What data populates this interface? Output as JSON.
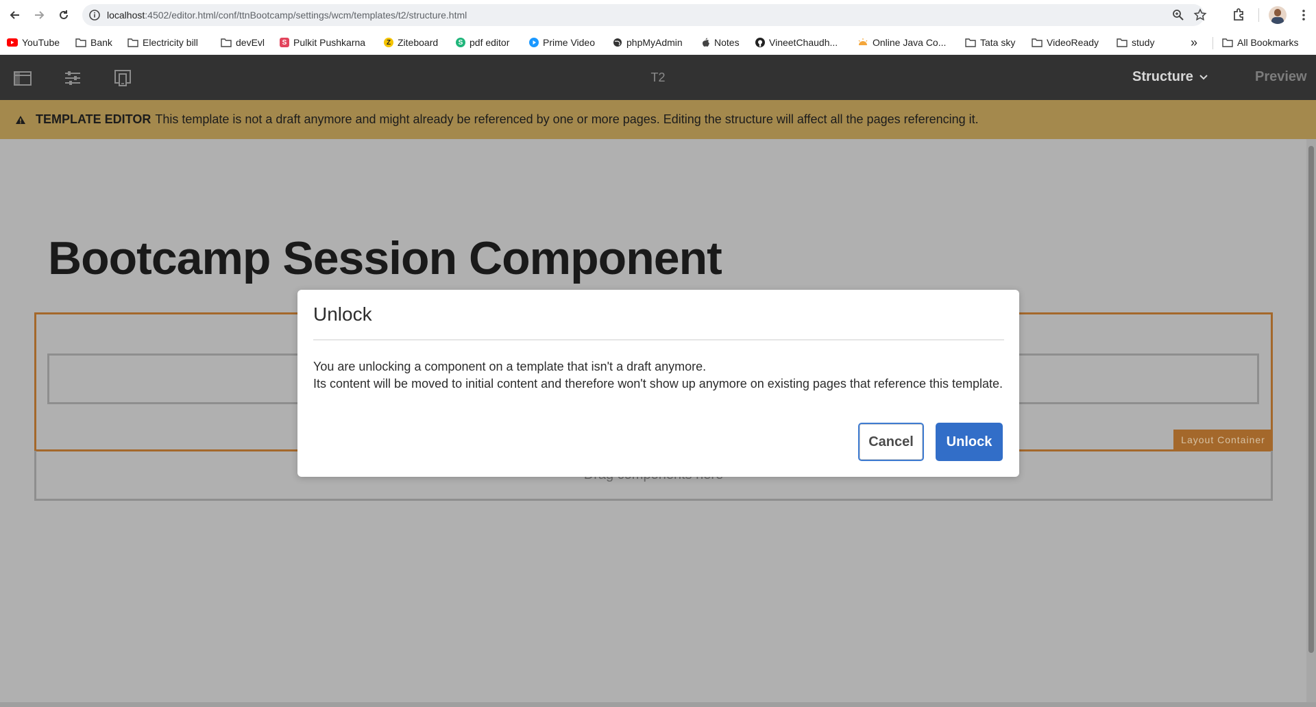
{
  "browser": {
    "url_host": "localhost",
    "url_rest": ":4502/editor.html/conf/ttnBootcamp/settings/wcm/templates/t2/structure.html",
    "bookmarks": [
      {
        "label": "YouTube",
        "icon": "youtube-icon"
      },
      {
        "label": "Bank",
        "icon": "folder-icon"
      },
      {
        "label": "Electricity bill",
        "icon": "folder-icon"
      },
      {
        "label": "devEvl",
        "icon": "folder-icon"
      },
      {
        "label": "Pulkit Pushkarna",
        "icon": "site-s-icon"
      },
      {
        "label": "Ziteboard",
        "icon": "ziteboard-icon"
      },
      {
        "label": "pdf editor",
        "icon": "pdf-editor-icon"
      },
      {
        "label": "Prime Video",
        "icon": "prime-video-icon"
      },
      {
        "label": "phpMyAdmin",
        "icon": "globe-icon"
      },
      {
        "label": "Notes",
        "icon": "apple-icon"
      },
      {
        "label": "VineetChaudh...",
        "icon": "github-icon"
      },
      {
        "label": "Online Java Co...",
        "icon": "sun-icon"
      },
      {
        "label": "Tata sky",
        "icon": "folder-icon"
      },
      {
        "label": "VideoReady",
        "icon": "folder-icon"
      },
      {
        "label": "study",
        "icon": "folder-icon"
      }
    ],
    "overflow_label": "»",
    "all_bookmarks_label": "All Bookmarks"
  },
  "editor": {
    "page_name": "T2",
    "mode_label": "Structure",
    "preview_label": "Preview",
    "warning_title": "TEMPLATE EDITOR",
    "warning_text": "This template is not a draft anymore and might already be referenced by one or more pages. Editing the structure will affect all the pages referencing it."
  },
  "page": {
    "title": "Bootcamp Session Component",
    "layout_container_label": "Layout Container",
    "drag_placeholder": "Drag components here"
  },
  "dialog": {
    "title": "Unlock",
    "line1": "You are unlocking a component on a template that isn't a draft anymore.",
    "line2": "Its content will be moved to initial content and therefore won't show up anymore on existing pages that reference this template.",
    "cancel_label": "Cancel",
    "unlock_label": "Unlock"
  },
  "colors": {
    "editor_bar": "#323232",
    "warning_bar": "#a4894d",
    "layout_container": "#a4682b",
    "primary_button": "#326ec8"
  }
}
